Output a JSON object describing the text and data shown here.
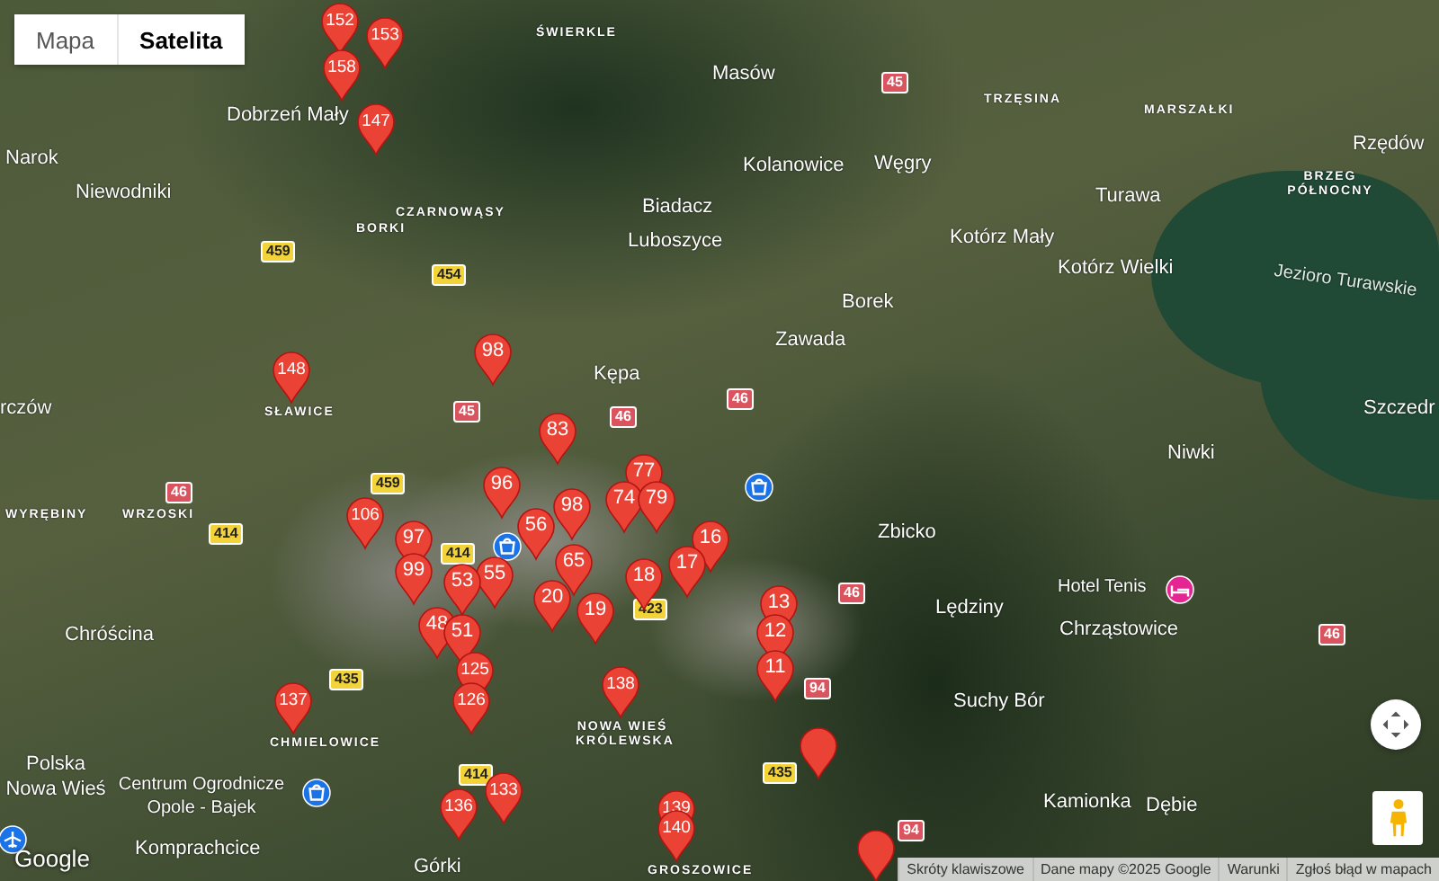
{
  "map_type_control": [
    {
      "label": "Mapa",
      "selected": false
    },
    {
      "label": "Satelita",
      "selected": true
    }
  ],
  "places": [
    {
      "name": "Narok",
      "kind": "town"
    },
    {
      "name": "Niewodniki",
      "kind": "town"
    },
    {
      "name": "Dobrzeń Mały",
      "kind": "town"
    },
    {
      "name": "ŚWIERKLE",
      "kind": "village"
    },
    {
      "name": "Masów",
      "kind": "town"
    },
    {
      "name": "Kolanowice",
      "kind": "town"
    },
    {
      "name": "Węgry",
      "kind": "town"
    },
    {
      "name": "Biadacz",
      "kind": "town"
    },
    {
      "name": "Luboszyce",
      "kind": "town"
    },
    {
      "name": "Borek",
      "kind": "town"
    },
    {
      "name": "Zawada",
      "kind": "town"
    },
    {
      "name": "TRZĘSINA",
      "kind": "village"
    },
    {
      "name": "MARSZAŁKI",
      "kind": "village"
    },
    {
      "name": "Rzędów",
      "kind": "town"
    },
    {
      "name": "BRZEG PÓŁNOCNY",
      "kind": "village"
    },
    {
      "name": "Turawa",
      "kind": "town"
    },
    {
      "name": "Kotórz Mały",
      "kind": "town"
    },
    {
      "name": "Kotórz Wielki",
      "kind": "town"
    },
    {
      "name": "Jezioro Turawskie",
      "kind": "lake"
    },
    {
      "name": "Szczedr",
      "kind": "town"
    },
    {
      "name": "CZARNOWĄSY",
      "kind": "village"
    },
    {
      "name": "BORKI",
      "kind": "village"
    },
    {
      "name": "rczów",
      "kind": "town"
    },
    {
      "name": "SŁAWICE",
      "kind": "village"
    },
    {
      "name": "Kępa",
      "kind": "town"
    },
    {
      "name": "WYRĘBINY",
      "kind": "village"
    },
    {
      "name": "WRZOSKI",
      "kind": "village"
    },
    {
      "name": "Chróścina",
      "kind": "town"
    },
    {
      "name": "CHMIELOWICE",
      "kind": "village"
    },
    {
      "name": "Polska Nowa Wieś",
      "kind": "town"
    },
    {
      "name": "Centrum Ogrodnicze Opole - Bajek",
      "kind": "poi"
    },
    {
      "name": "Komprachcice",
      "kind": "town"
    },
    {
      "name": "Górki",
      "kind": "town"
    },
    {
      "name": "NOWA WIEŚ KRÓLEWSKA",
      "kind": "village"
    },
    {
      "name": "GROSZOWICE",
      "kind": "village"
    },
    {
      "name": "Zbicko",
      "kind": "town"
    },
    {
      "name": "Niwki",
      "kind": "town"
    },
    {
      "name": "Hotel Tenis",
      "kind": "poi"
    },
    {
      "name": "Lędziny",
      "kind": "town"
    },
    {
      "name": "Chrząstowice",
      "kind": "town"
    },
    {
      "name": "Suchy Bór",
      "kind": "town"
    },
    {
      "name": "Kamionka",
      "kind": "town"
    },
    {
      "name": "Dębie",
      "kind": "town"
    }
  ],
  "roads": [
    {
      "number": "45",
      "color": "#d9545e"
    },
    {
      "number": "459",
      "color": "#f2d43a"
    },
    {
      "number": "454",
      "color": "#f2d43a"
    },
    {
      "number": "45",
      "color": "#d9545e"
    },
    {
      "number": "46",
      "color": "#d9545e"
    },
    {
      "number": "46",
      "color": "#d9545e"
    },
    {
      "number": "46",
      "color": "#d9545e"
    },
    {
      "number": "459",
      "color": "#f2d43a"
    },
    {
      "number": "414",
      "color": "#f2d43a"
    },
    {
      "number": "414",
      "color": "#f2d43a"
    },
    {
      "number": "423",
      "color": "#f2d43a"
    },
    {
      "number": "46",
      "color": "#d9545e"
    },
    {
      "number": "94",
      "color": "#d9545e"
    },
    {
      "number": "435",
      "color": "#f2d43a"
    },
    {
      "number": "435",
      "color": "#f2d43a"
    },
    {
      "number": "414",
      "color": "#f2d43a"
    },
    {
      "number": "94",
      "color": "#d9545e"
    },
    {
      "number": "46",
      "color": "#d9545e"
    }
  ],
  "poi_pins": [
    {
      "kind": "shopping"
    },
    {
      "kind": "shopping"
    },
    {
      "kind": "shopping"
    },
    {
      "kind": "hotel"
    },
    {
      "kind": "airport"
    }
  ],
  "markers": [
    {
      "label": "152"
    },
    {
      "label": "153"
    },
    {
      "label": "158"
    },
    {
      "label": "147"
    },
    {
      "label": "148"
    },
    {
      "label": "98"
    },
    {
      "label": "83"
    },
    {
      "label": "96"
    },
    {
      "label": "98"
    },
    {
      "label": "56"
    },
    {
      "label": "65"
    },
    {
      "label": "77"
    },
    {
      "label": "74"
    },
    {
      "label": "79"
    },
    {
      "label": "16"
    },
    {
      "label": "17"
    },
    {
      "label": "18"
    },
    {
      "label": "19"
    },
    {
      "label": "20"
    },
    {
      "label": "55"
    },
    {
      "label": "13"
    },
    {
      "label": "12"
    },
    {
      "label": "11"
    },
    {
      "label": "138"
    },
    {
      "label": "139"
    },
    {
      "label": "140"
    },
    {
      "label": "106"
    },
    {
      "label": "97"
    },
    {
      "label": "99"
    },
    {
      "label": "53"
    },
    {
      "label": "48"
    },
    {
      "label": "51"
    },
    {
      "label": "125"
    },
    {
      "label": "126"
    },
    {
      "label": "137"
    },
    {
      "label": "136"
    },
    {
      "label": "133"
    },
    {
      "kind": "plain"
    },
    {
      "kind": "plain"
    }
  ],
  "logo": "Google",
  "footer": [
    "Skróty klawiszowe",
    "Dane mapy ©2025 Google",
    "Warunki",
    "Zgłoś błąd w mapach"
  ]
}
